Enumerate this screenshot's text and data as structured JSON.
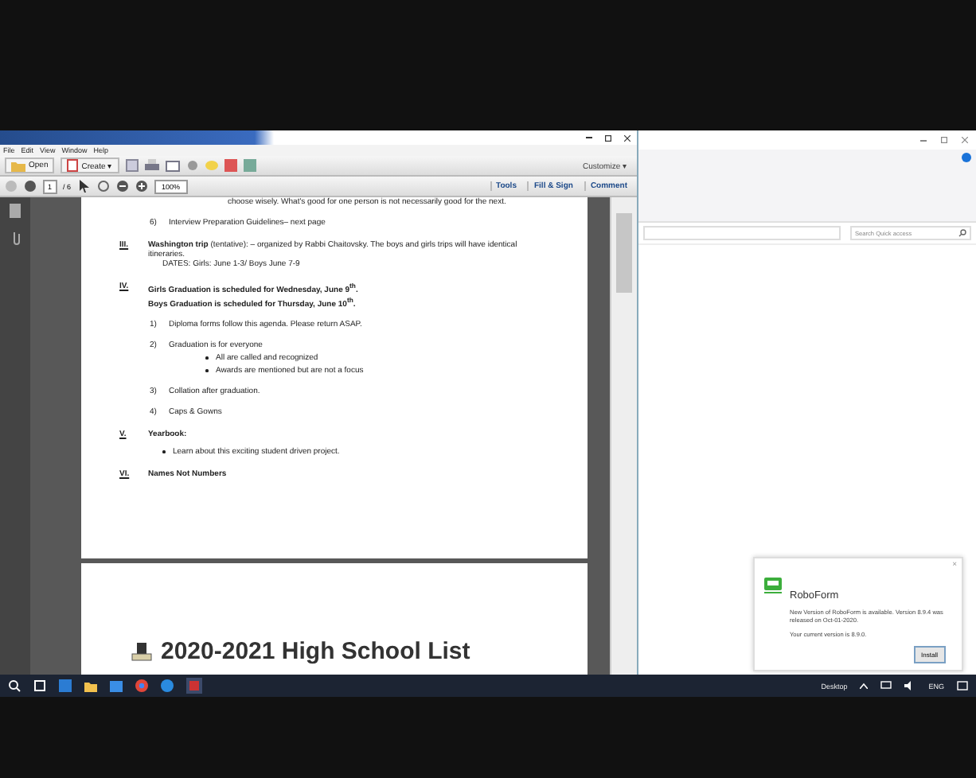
{
  "acrobat": {
    "menu": [
      "File",
      "Edit",
      "View",
      "Window",
      "Help"
    ],
    "toolbar": {
      "open": "Open",
      "create": "Create ▾",
      "customize": "Customize ▾"
    },
    "nav": {
      "page": "1",
      "pages": "/ 6",
      "zoom": "100%",
      "tabs": [
        "Tools",
        "Fill & Sign",
        "Comment"
      ]
    },
    "document": {
      "cut_line": "choose wisely.  What's good for one person is not necessarily good for the next.",
      "blocks": [
        {
          "kind": "numbered",
          "num": "6)",
          "text": "Interview Preparation Guidelines– next page"
        },
        {
          "kind": "section",
          "num": "III.",
          "bold": false,
          "lines": [
            "**Washington trip** (tentative): – organized by Rabbi Chaitovsky. The boys and girls trips will have identical itineraries."
          ],
          "sub": "DATES: Girls: June 1-3/ Boys June 7-9"
        },
        {
          "kind": "section",
          "num": "IV.",
          "bold": true,
          "lines": [
            "Girls Graduation is scheduled for Wednesday, June 9$^{th}$.",
            "Boys Graduation is scheduled for Thursday, June 10$^{th}$."
          ]
        },
        {
          "kind": "numbered",
          "num": "1)",
          "text": "Diploma forms follow this agenda. Please return ASAP."
        },
        {
          "kind": "numbered",
          "num": "2)",
          "text": "Graduation is for everyone",
          "bullets": [
            "All are called and recognized",
            "Awards are mentioned but are not a focus"
          ]
        },
        {
          "kind": "numbered",
          "num": "3)",
          "text": "Collation after graduation."
        },
        {
          "kind": "numbered",
          "num": "4)",
          "text": "Caps & Gowns"
        },
        {
          "kind": "section",
          "num": "V.",
          "bold": true,
          "lines": [
            "Yearbook:"
          ]
        },
        {
          "kind": "bullet",
          "text": "Learn about this exciting student driven project."
        },
        {
          "kind": "section",
          "num": "VI.",
          "bold": true,
          "lines": [
            "Names Not Numbers"
          ]
        }
      ],
      "page2_title": "2020-2021 High School List"
    }
  },
  "explorer": {
    "search": {
      "placeholder": "Search Quick access"
    }
  },
  "notification": {
    "close": "×",
    "app": "RoboForm",
    "message": "New Version of RoboForm is available. Version 8.9.4 was released on Oct-01-2020.",
    "current": "Your current version is 8.9.0.",
    "button": "Install"
  },
  "taskbar": {
    "desktop": "Desktop",
    "lang": "ENG"
  }
}
